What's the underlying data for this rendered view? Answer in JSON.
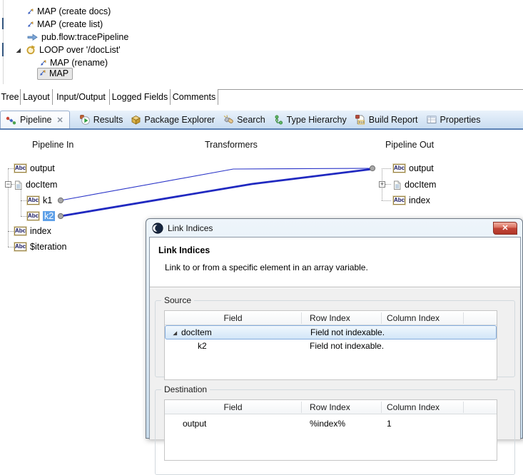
{
  "flow_tree": {
    "items": [
      {
        "label": "MAP (create docs)",
        "icon": "map-icon"
      },
      {
        "label": "MAP (create list)",
        "icon": "map-icon"
      },
      {
        "label": "pub.flow:tracePipeline",
        "icon": "invoke-arrow-icon"
      },
      {
        "label": "LOOP over '/docList'",
        "icon": "loop-icon",
        "expanded": true
      },
      {
        "label": "MAP (rename)",
        "icon": "map-icon"
      },
      {
        "label": "MAP",
        "icon": "map-icon",
        "selected": true
      }
    ]
  },
  "editor_tabs": {
    "items": [
      {
        "label": "Tree",
        "active": true
      },
      {
        "label": "Layout"
      },
      {
        "label": "Input/Output"
      },
      {
        "label": "Logged Fields"
      },
      {
        "label": "Comments"
      }
    ]
  },
  "view_tabs": {
    "items": [
      {
        "label": "Pipeline",
        "icon": "pipeline-icon",
        "active": true,
        "closable": true
      },
      {
        "label": "Results",
        "icon": "results-icon"
      },
      {
        "label": "Package Explorer",
        "icon": "package-explorer-icon"
      },
      {
        "label": "Search",
        "icon": "search-icon"
      },
      {
        "label": "Type Hierarchy",
        "icon": "type-hierarchy-icon"
      },
      {
        "label": "Build Report",
        "icon": "build-report-icon"
      },
      {
        "label": "Properties",
        "icon": "properties-icon"
      }
    ]
  },
  "pipeline": {
    "columns": {
      "in": "Pipeline In",
      "transformers": "Transformers",
      "out": "Pipeline Out"
    },
    "in_tree": [
      {
        "label": "output",
        "icon": "string-abc-icon"
      },
      {
        "label": "docItem",
        "icon": "document-icon",
        "expanded": true
      },
      {
        "label": "k1",
        "icon": "string-abc-icon",
        "linked": true
      },
      {
        "label": "k2",
        "icon": "string-abc-icon",
        "linked": true,
        "selected": true
      },
      {
        "label": "index",
        "icon": "string-abc-icon"
      },
      {
        "label": "$iteration",
        "icon": "string-abc-icon"
      }
    ],
    "out_tree": [
      {
        "label": "output",
        "icon": "string-abc-icon",
        "linked": true
      },
      {
        "label": "docItem",
        "icon": "document-icon",
        "collapsed": true
      },
      {
        "label": "index",
        "icon": "string-abc-icon"
      }
    ]
  },
  "dialog": {
    "title": "Link Indices",
    "heading": "Link Indices",
    "description": "Link to or from a specific element in an array variable.",
    "source": {
      "label": "Source",
      "columns": [
        "Field",
        "Row Index",
        "Column Index"
      ],
      "rows": [
        {
          "field": "docItem",
          "row_index": "Field not indexable.",
          "column_index": "",
          "expanded": true,
          "selected": true
        },
        {
          "field": "k2",
          "row_index": "Field not indexable.",
          "column_index": ""
        }
      ]
    },
    "destination": {
      "label": "Destination",
      "columns": [
        "Field",
        "Row Index",
        "Column Index"
      ],
      "rows": [
        {
          "field": "output",
          "row_index": "%index%",
          "column_index": "1"
        }
      ]
    }
  },
  "icons": {
    "abc_label": "Abc",
    "expand_minus": "−",
    "expand_plus": "+",
    "close_glyph": "✕",
    "tab_close_glyph": "✕"
  },
  "colors": {
    "link_line": "#2029c0",
    "tree_selection": "#5ea0e8",
    "close_button": "#c4473a",
    "tabbar_accent": "#5c82b5"
  }
}
